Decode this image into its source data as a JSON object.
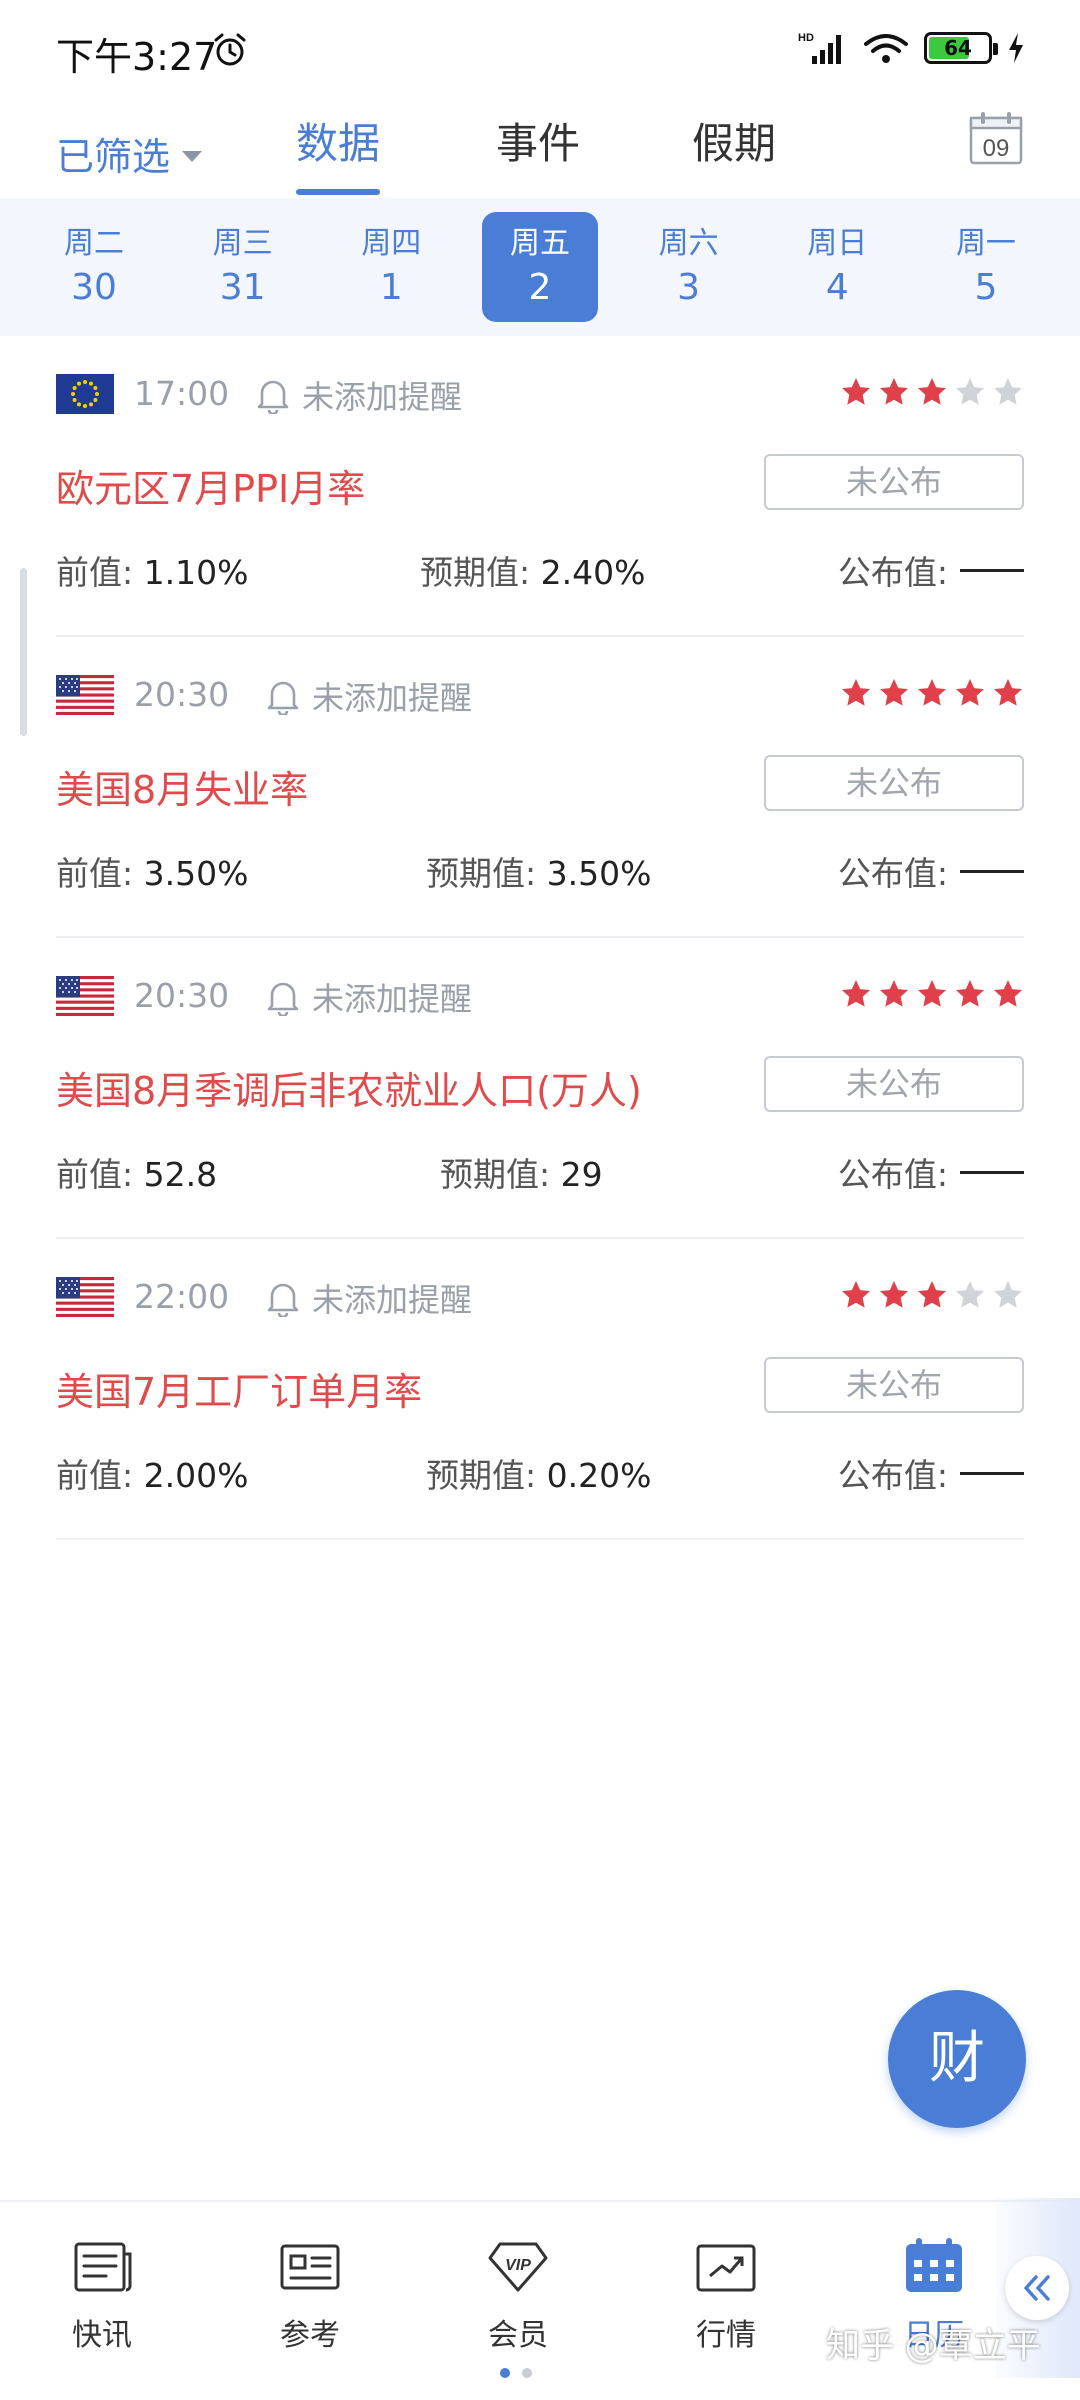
{
  "status_bar": {
    "time": "下午3:27",
    "battery": "64"
  },
  "header": {
    "filter_label": "已筛选",
    "tabs": [
      {
        "label": "数据",
        "active": true
      },
      {
        "label": "事件",
        "active": false
      },
      {
        "label": "假期",
        "active": false
      }
    ],
    "calendar_day": "09"
  },
  "week": [
    {
      "name": "周二",
      "num": "30",
      "active": false
    },
    {
      "name": "周三",
      "num": "31",
      "active": false
    },
    {
      "name": "周四",
      "num": "1",
      "active": false
    },
    {
      "name": "周五",
      "num": "2",
      "active": true
    },
    {
      "name": "周六",
      "num": "3",
      "active": false
    },
    {
      "name": "周日",
      "num": "4",
      "active": false
    },
    {
      "name": "周一",
      "num": "5",
      "active": false
    }
  ],
  "events": [
    {
      "flag": "eu-flag-icon",
      "time": "17:00",
      "reminder": "未添加提醒",
      "stars": 3,
      "title": "欧元区7月PPI月率",
      "status": "未公布",
      "prev_label": "前值:",
      "prev_value": "1.10%",
      "expected_label": "预期值:",
      "expected_value": "2.40%",
      "published_label": "公布值:"
    },
    {
      "flag": "us-flag-icon",
      "time": "20:30",
      "reminder": "未添加提醒",
      "stars": 5,
      "title": "美国8月失业率",
      "status": "未公布",
      "prev_label": "前值:",
      "prev_value": "3.50%",
      "expected_label": "预期值:",
      "expected_value": "3.50%",
      "published_label": "公布值:"
    },
    {
      "flag": "us-flag-icon",
      "time": "20:30",
      "reminder": "未添加提醒",
      "stars": 5,
      "title": "美国8月季调后非农就业人口(万人)",
      "status": "未公布",
      "prev_label": "前值:",
      "prev_value": "52.8",
      "expected_label": "预期值:",
      "expected_value": "29",
      "published_label": "公布值:"
    },
    {
      "flag": "us-flag-icon",
      "time": "22:00",
      "reminder": "未添加提醒",
      "stars": 3,
      "title": "美国7月工厂订单月率",
      "status": "未公布",
      "prev_label": "前值:",
      "prev_value": "2.00%",
      "expected_label": "预期值:",
      "expected_value": "0.20%",
      "published_label": "公布值:"
    }
  ],
  "fab_label": "财",
  "bottom_nav": [
    {
      "label": "快讯",
      "icon": "newspaper-icon",
      "active": false
    },
    {
      "label": "参考",
      "icon": "id-card-icon",
      "active": false
    },
    {
      "label": "会员",
      "icon": "vip-diamond-icon",
      "active": false
    },
    {
      "label": "行情",
      "icon": "trend-chart-icon",
      "active": false
    },
    {
      "label": "日历",
      "icon": "calendar-icon",
      "active": true
    }
  ],
  "watermark": "知乎 @覃立平",
  "colors": {
    "accent": "#4a7ed6",
    "title_red": "#e04a4a",
    "star_red": "#e0404a",
    "star_grey": "#d0d3d8",
    "week_bg": "#f3f6fc"
  }
}
